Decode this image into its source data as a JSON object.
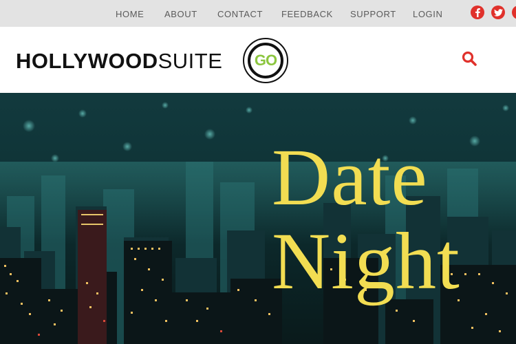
{
  "topnav": {
    "items": [
      "HOME",
      "ABOUT",
      "CONTACT",
      "FEEDBACK",
      "SUPPORT",
      "LOGIN"
    ]
  },
  "social": {
    "icons": [
      "facebook-icon",
      "twitter-icon",
      "partially-visible-social-icon"
    ],
    "color": "#e0312b"
  },
  "header": {
    "logo_bold": "HOLLYWOOD",
    "logo_light": "SUITE",
    "badge_text": "GO",
    "badge_color": "#8cc63f",
    "search_icon": "search-icon",
    "search_color": "#e0312b"
  },
  "hero": {
    "title_line1": "Date",
    "title_line2": "Night",
    "title_color": "#f2dd52"
  }
}
